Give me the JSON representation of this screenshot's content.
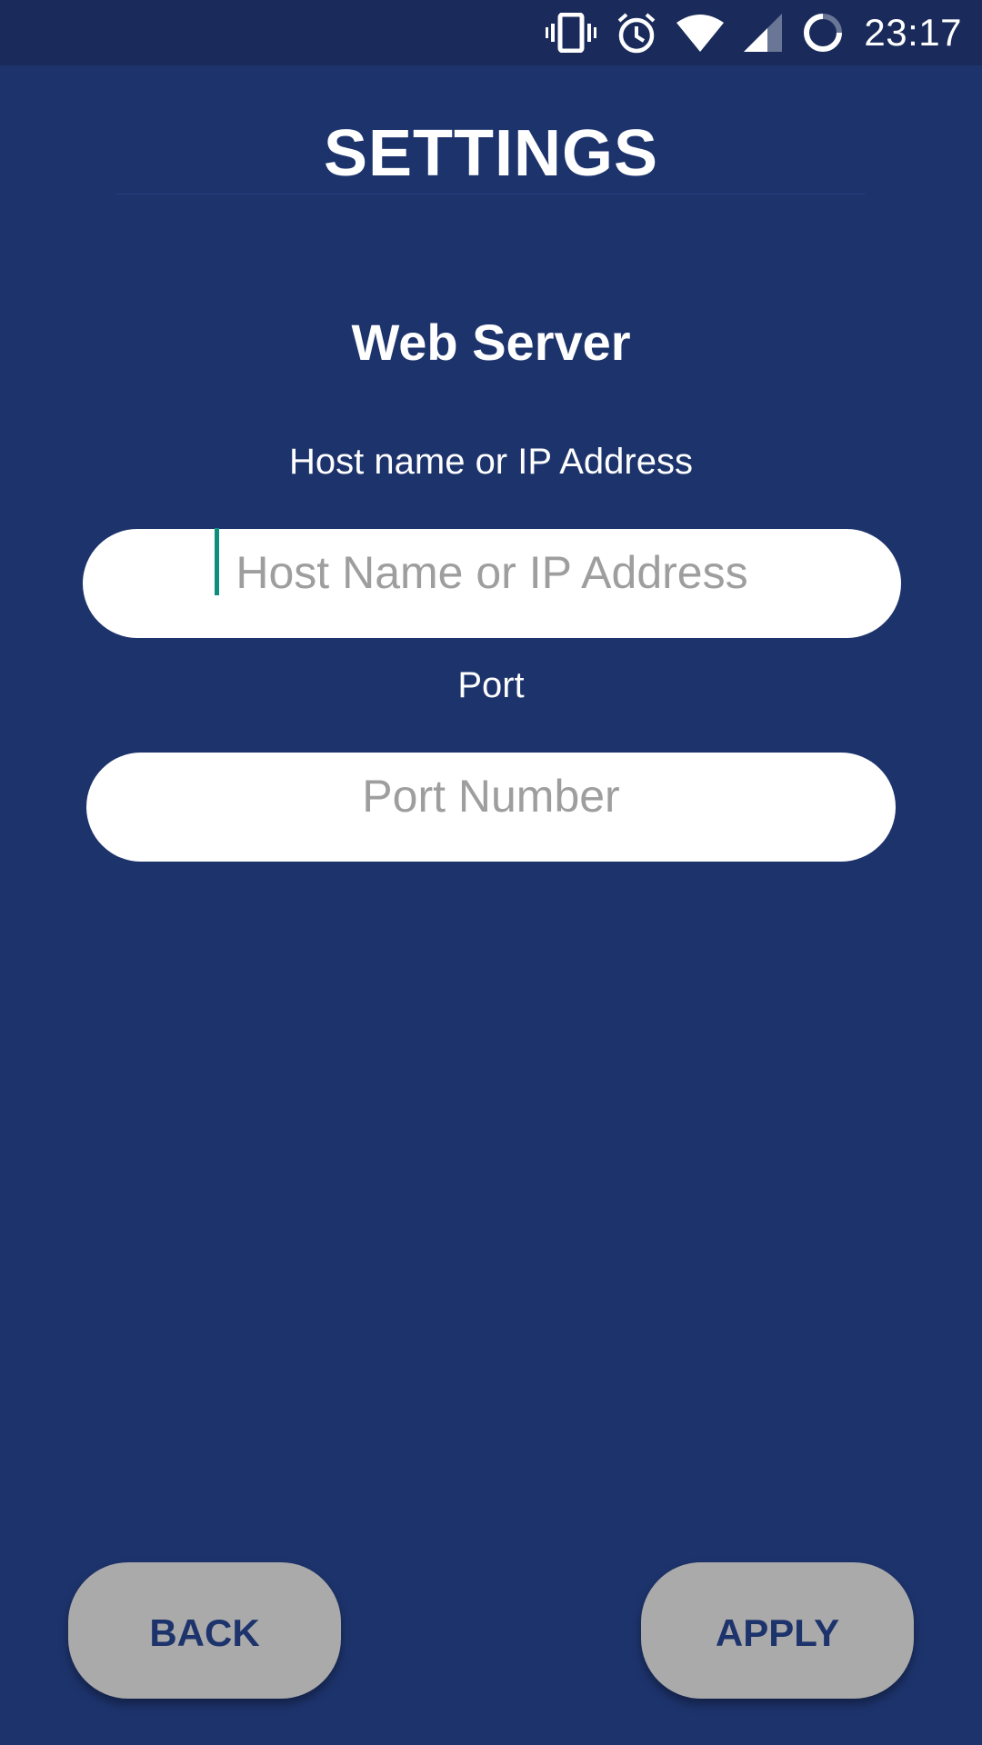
{
  "status_bar": {
    "time": "23:17",
    "icons": [
      "vibrate-icon",
      "alarm-icon",
      "wifi-icon",
      "cell-signal-icon",
      "battery-loading-icon"
    ]
  },
  "header": {
    "title": "SETTINGS"
  },
  "web_server": {
    "section_title": "Web Server",
    "host": {
      "label": "Host name or IP Address",
      "value": "",
      "placeholder": "Host Name or IP Address"
    },
    "port": {
      "label": "Port",
      "value": "",
      "placeholder": "Port Number"
    }
  },
  "actions": {
    "back_label": "BACK",
    "apply_label": "APPLY"
  },
  "colors": {
    "background": "#1d336c",
    "status_bar": "#1a2b5b",
    "button": "#aaaaaa",
    "button_text": "#1d336c",
    "cursor": "#0e8f7e"
  }
}
